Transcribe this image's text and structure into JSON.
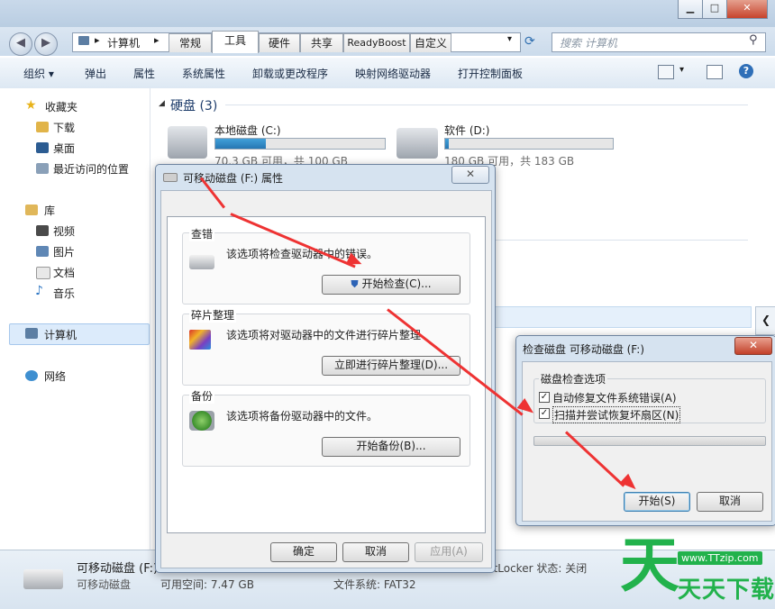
{
  "explorer": {
    "address": "计算机",
    "search_placeholder": "搜索 计算机",
    "commands": [
      "组织 ▾",
      "弹出",
      "属性",
      "系统属性",
      "卸载或更改程序",
      "映射网络驱动器",
      "打开控制面板"
    ],
    "nav": {
      "favorites": "收藏夹",
      "favorites_items": [
        "下载",
        "桌面",
        "最近访问的位置"
      ],
      "libraries": "库",
      "libraries_items": [
        "视频",
        "图片",
        "文档",
        "音乐"
      ],
      "computer": "计算机",
      "network": "网络"
    },
    "section_title": "硬盘 (3)",
    "drives": [
      {
        "name": "本地磁盘 (C:)",
        "info": "70.3 GB 可用，共 100 GB",
        "used_fraction": 0.3
      },
      {
        "name": "软件 (D:)",
        "info": "180 GB 可用，共 183 GB",
        "used_fraction": 0.02
      }
    ],
    "status": {
      "name": "可移动磁盘 (F:)",
      "type": "可移动磁盘",
      "free": "可用空间: 7.47 GB",
      "fs": "文件系统: FAT32",
      "bitlocker": "BitLocker 状态: 关闭"
    }
  },
  "props": {
    "title": "可移动磁盘 (F:) 属性",
    "tabs": [
      "常规",
      "工具",
      "硬件",
      "共享",
      "ReadyBoost",
      "自定义"
    ],
    "check": {
      "title": "查错",
      "desc": "该选项将检查驱动器中的错误。",
      "button": "开始检查(C)..."
    },
    "defrag": {
      "title": "碎片整理",
      "desc": "该选项将对驱动器中的文件进行碎片整理",
      "button": "立即进行碎片整理(D)..."
    },
    "backup": {
      "title": "备份",
      "desc": "该选项将备份驱动器中的文件。",
      "button": "开始备份(B)..."
    },
    "ok": "确定",
    "cancel": "取消",
    "apply": "应用(A)"
  },
  "chk": {
    "title": "检查磁盘 可移动磁盘 (F:)",
    "group": "磁盘检查选项",
    "opt1": "自动修复文件系统错误(A)",
    "opt2": "扫描并尝试恢复坏扇区(N)",
    "start": "开始(S)",
    "cancel": "取消"
  },
  "watermark": {
    "url": "www.TTzip.com",
    "text": "天天下载"
  }
}
